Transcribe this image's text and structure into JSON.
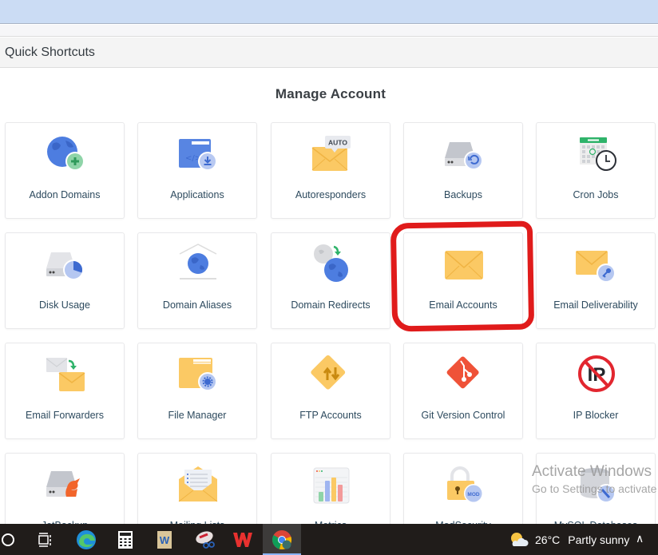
{
  "browser": {
    "top_strip": ""
  },
  "quick_shortcuts": {
    "title": "Quick Shortcuts"
  },
  "section": {
    "title": "Manage Account"
  },
  "tiles": [
    {
      "label": "Addon Domains",
      "icon": "globe-add-icon"
    },
    {
      "label": "Applications",
      "icon": "app-install-icon"
    },
    {
      "label": "Autoresponders",
      "icon": "auto-envelope-icon",
      "badge": "AUTO"
    },
    {
      "label": "Backups",
      "icon": "disk-restore-icon"
    },
    {
      "label": "Cron Jobs",
      "icon": "calendar-clock-icon"
    },
    {
      "label": "Disk Usage",
      "icon": "disk-pie-icon"
    },
    {
      "label": "Domain Aliases",
      "icon": "house-globe-icon"
    },
    {
      "label": "Domain Redirects",
      "icon": "globe-redirect-icon"
    },
    {
      "label": "Email Accounts",
      "icon": "envelope-icon",
      "highlighted": true
    },
    {
      "label": "Email Deliverability",
      "icon": "envelope-key-icon"
    },
    {
      "label": "Email Forwarders",
      "icon": "envelope-forward-icon"
    },
    {
      "label": "File Manager",
      "icon": "folder-gear-icon"
    },
    {
      "label": "FTP Accounts",
      "icon": "ftp-arrows-icon"
    },
    {
      "label": "Git Version Control",
      "icon": "git-icon"
    },
    {
      "label": "IP Blocker",
      "icon": "ip-block-icon",
      "badge": "IP"
    },
    {
      "label": "JetBackup",
      "icon": "disk-jet-icon"
    },
    {
      "label": "Mailing Lists",
      "icon": "envelope-list-icon"
    },
    {
      "label": "Metrics",
      "icon": "bar-chart-icon"
    },
    {
      "label": "ModSecurity",
      "icon": "lock-mod-icon",
      "badge": "MOD"
    },
    {
      "label": "MySQL Databases",
      "icon": "database-wizard-icon"
    }
  ],
  "watermark": {
    "line1": "Activate Windows",
    "line2": "Go to Settings to activate Windows."
  },
  "taskbar": {
    "items": [
      {
        "name": "cortana",
        "icon": "circle-search-icon"
      },
      {
        "name": "task-view",
        "icon": "task-view-icon"
      },
      {
        "name": "edge",
        "icon": "edge-icon"
      },
      {
        "name": "calculator",
        "icon": "calculator-icon"
      },
      {
        "name": "word",
        "icon": "word-icon"
      },
      {
        "name": "snipping-tool",
        "icon": "snipping-icon"
      },
      {
        "name": "wps-office",
        "icon": "wps-icon"
      },
      {
        "name": "chrome",
        "icon": "chrome-icon",
        "active": true
      }
    ],
    "weather": {
      "temp": "26°C",
      "condition": "Partly sunny"
    }
  },
  "colors": {
    "highlight": "#e01b1b",
    "label": "#2d4a5e",
    "topbar": "#cbdcf4"
  }
}
